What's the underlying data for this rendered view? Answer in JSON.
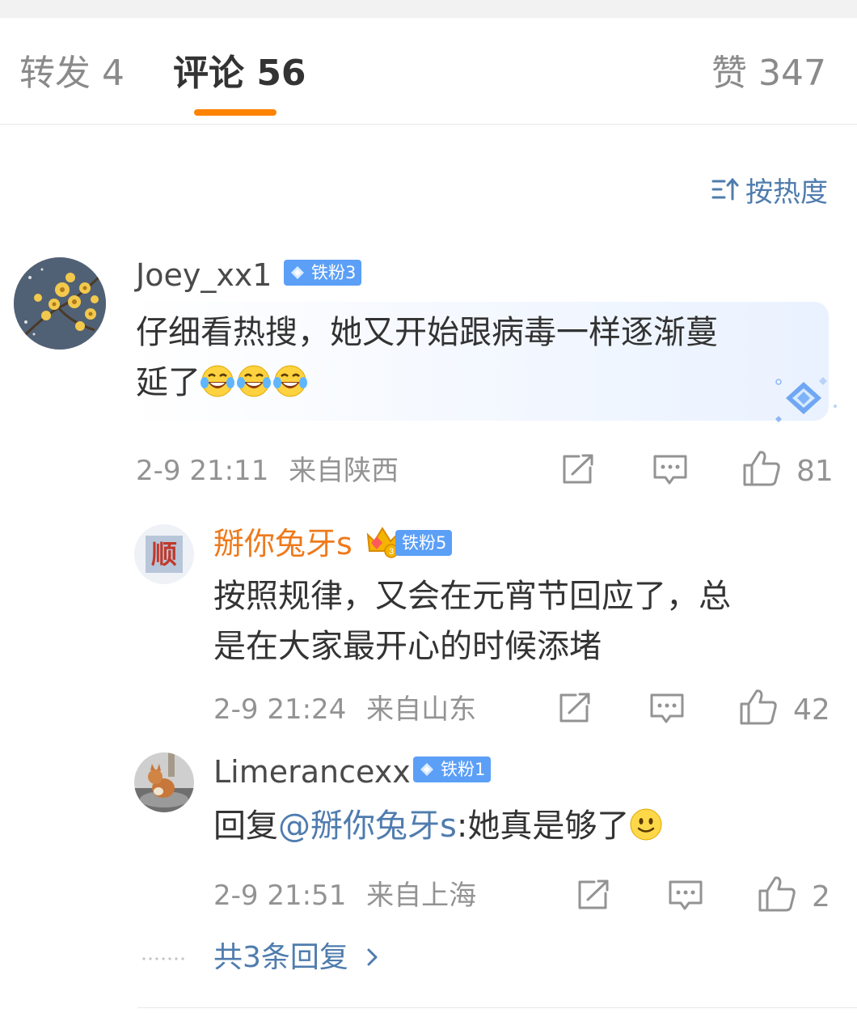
{
  "tabs": {
    "reposts": "转发 4",
    "comments": "评论 56",
    "likes": "赞 347"
  },
  "sort": {
    "label": "按热度",
    "icon": "sort-icon"
  },
  "accent_color": "#ff8200",
  "link_color": "#4f7cae",
  "comment": {
    "username": "Joey_xx1",
    "fan_badge": "铁粉3",
    "text_line1": "仔细看热搜，她又开始跟病毒一样逐渐蔓",
    "text_line2": "延了",
    "emoji": "laugh-cry-emoji",
    "emoji_count": 3,
    "time": "2-9 21:11",
    "location": "来自陕西",
    "likes": "81"
  },
  "replies": [
    {
      "username": "掰你兔牙s",
      "fan_badge": "铁粉5",
      "avatar_text": "顺",
      "text_line1": "按照规律，又会在元宵节回应了，总",
      "text_line2": "是在大家最开心的时候添堵",
      "time": "2-9 21:24",
      "location": "来自山东",
      "likes": "42"
    },
    {
      "username": "Limerancexx",
      "fan_badge": "铁粉1",
      "reply_prefix": "回复",
      "mention": "@掰你兔牙s",
      "reply_text": ":她真是够了",
      "emoji": "smile-emoji",
      "time": "2-9 21:51",
      "location": "来自上海",
      "likes": "2"
    }
  ],
  "more_replies": "共3条回复"
}
